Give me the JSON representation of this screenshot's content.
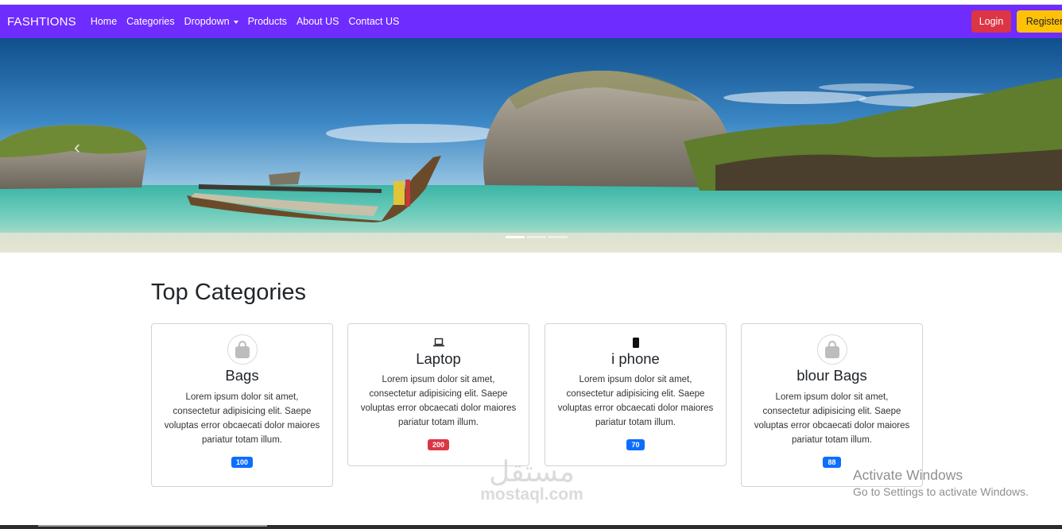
{
  "navbar": {
    "brand": "FASHTIONS",
    "links": [
      "Home",
      "Categories",
      "Dropdown",
      "Products",
      "About US",
      "Contact US"
    ],
    "login": "Login",
    "register": "Register",
    "color": "#6f2cff"
  },
  "hero": {
    "prev_icon": "‹",
    "indicators": 3,
    "active_indicator": 1
  },
  "section": {
    "title": "Top Categories"
  },
  "cards": [
    {
      "icon": "bag-icon",
      "title": "Bags",
      "desc": "Lorem ipsum dolor sit amet, consectetur adipisicing elit. Saepe voluptas error obcaecati dolor maiores pariatur totam illum.",
      "badge": "100",
      "badge_color": "#0d6efd"
    },
    {
      "icon": "laptop-icon",
      "title": "Laptop",
      "desc": "Lorem ipsum dolor sit amet, consectetur adipisicing elit. Saepe voluptas error obcaecati dolor maiores pariatur totam illum.",
      "badge": "200",
      "badge_color": "#dc3545"
    },
    {
      "icon": "phone-icon",
      "title": "i phone",
      "desc": "Lorem ipsum dolor sit amet, consectetur adipisicing elit. Saepe voluptas error obcaecati dolor maiores pariatur totam illum.",
      "badge": "70",
      "badge_color": "#0d6efd"
    },
    {
      "icon": "bag-icon",
      "title": "blour Bags",
      "desc": "Lorem ipsum dolor sit amet, consectetur adipisicing elit. Saepe voluptas error obcaecati dolor maiores pariatur totam illum.",
      "badge": "88",
      "badge_color": "#0d6efd"
    }
  ],
  "watermark": {
    "arabic": "مستقل",
    "latin": "mostaql.com"
  },
  "windows": {
    "line1": "Activate Windows",
    "line2": "Go to Settings to activate Windows."
  }
}
